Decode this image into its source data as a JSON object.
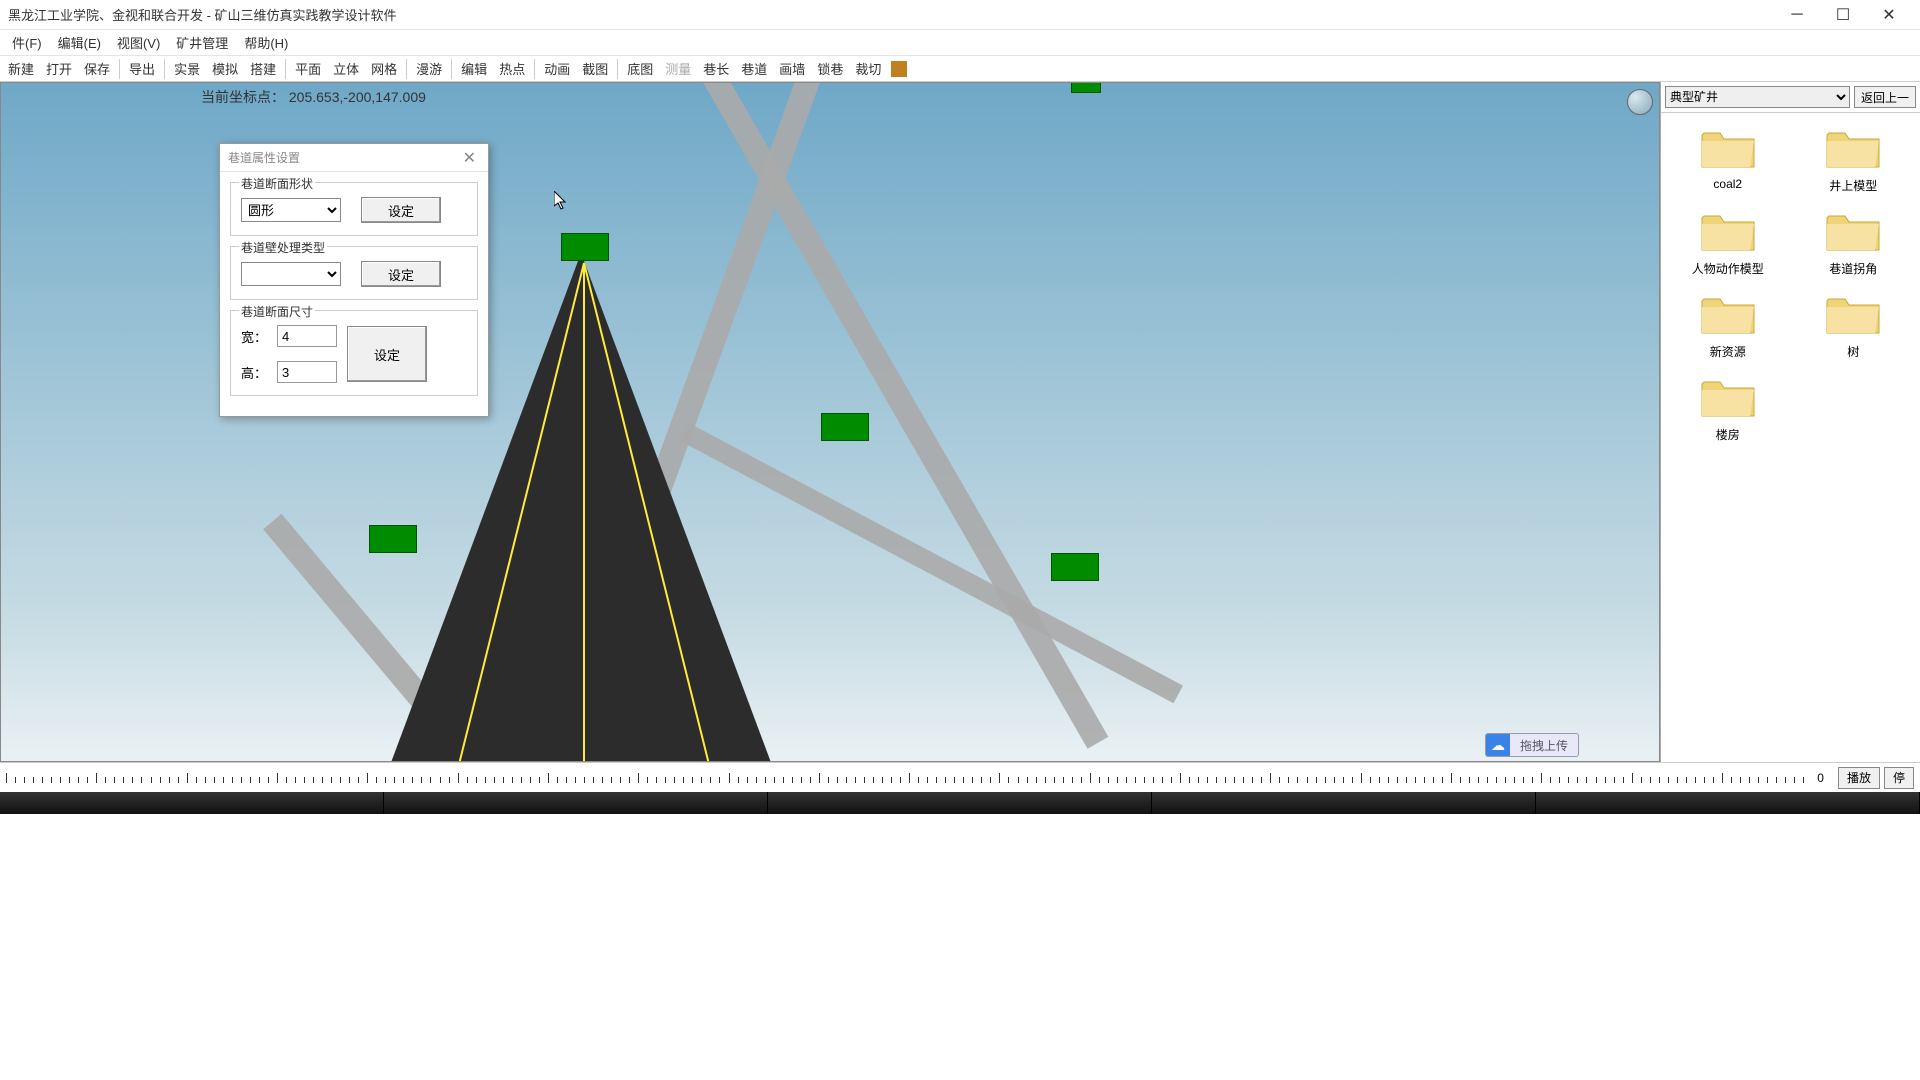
{
  "titlebar": {
    "text": "黑龙江工业学院、金视和联合开发 - 矿山三维仿真实践教学设计软件"
  },
  "menubar": {
    "file": "件(F)",
    "edit": "编辑(E)",
    "view": "视图(V)",
    "mine": "矿井管理",
    "help": "帮助(H)"
  },
  "toolbar": {
    "new": "新建",
    "open": "打开",
    "save": "保存",
    "export": "导出",
    "scene": "实景",
    "simulate": "模拟",
    "build": "搭建",
    "plane": "平面",
    "solid": "立体",
    "grid": "网格",
    "roam": "漫游",
    "edit": "编辑",
    "hotspot": "热点",
    "anim": "动画",
    "snapshot": "截图",
    "basemap": "底图",
    "measure": "测量",
    "length": "巷长",
    "tunnel": "巷道",
    "wall": "画墙",
    "lock": "锁巷",
    "crop": "裁切"
  },
  "viewport": {
    "coord_label": "当前坐标点：",
    "coord_value": "205.653,-200,147.009"
  },
  "dialog": {
    "title": "巷道属性设置",
    "group1_label": "巷道断面形状",
    "shape_value": "圆形",
    "set_btn": "设定",
    "group2_label": "巷道壁处理类型",
    "wall_value": "",
    "group3_label": "巷道断面尺寸",
    "width_label": "宽：",
    "width_value": "4",
    "height_label": "高：",
    "height_value": "3"
  },
  "rightpanel": {
    "combo_value": "典型矿井",
    "back_btn": "返回上一",
    "folders": {
      "f0": "coal2",
      "f1": "井上模型",
      "f2": "人物动作模型",
      "f3": "巷道拐角",
      "f4": "新资源",
      "f5": "树",
      "f6": "楼房"
    },
    "upload_label": "拖拽上传"
  },
  "timeline": {
    "value": "0",
    "play": "播放",
    "stop": "停"
  }
}
